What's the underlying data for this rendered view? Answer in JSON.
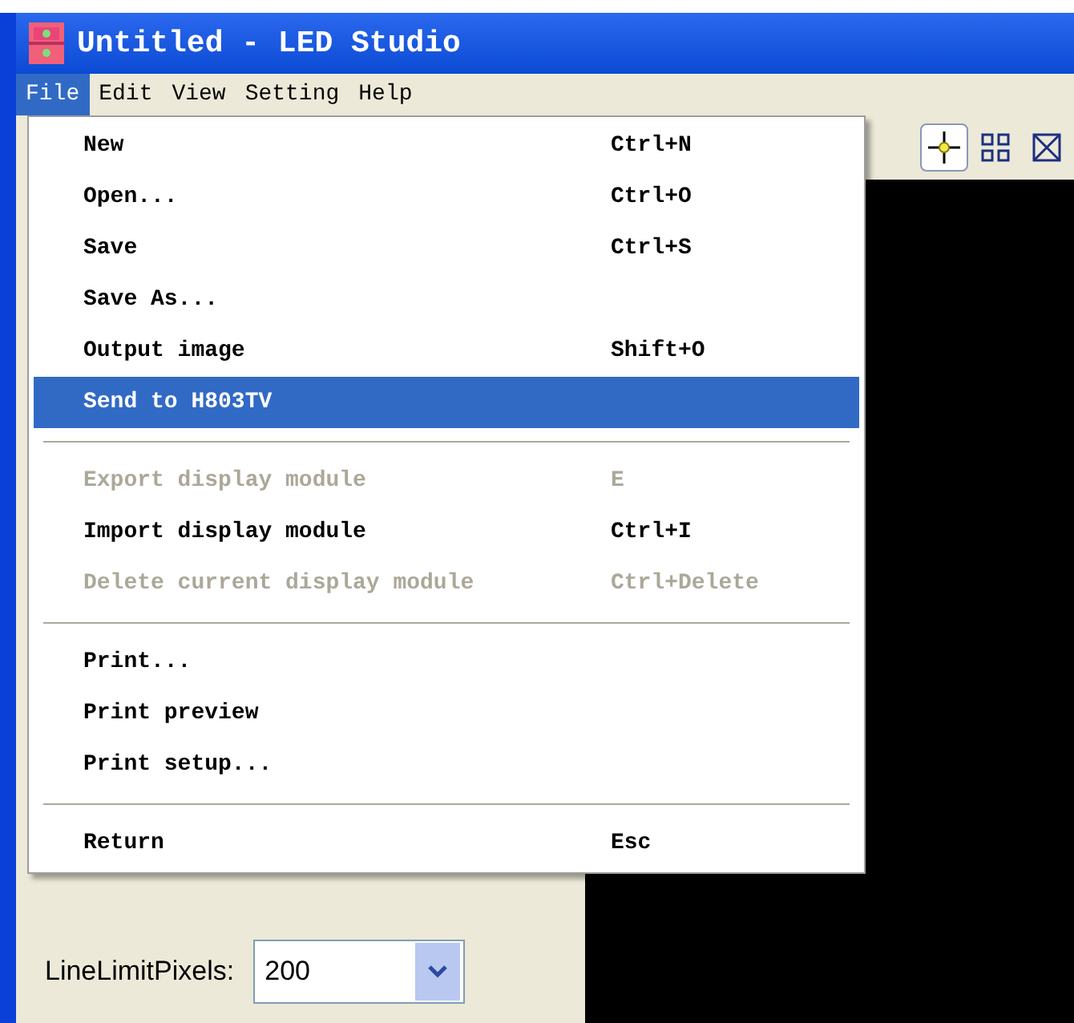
{
  "window": {
    "title": "Untitled - LED Studio"
  },
  "menubar": [
    {
      "label": "File",
      "selected": true
    },
    {
      "label": "Edit",
      "selected": false
    },
    {
      "label": "View",
      "selected": false
    },
    {
      "label": "Setting",
      "selected": false
    },
    {
      "label": "Help",
      "selected": false
    }
  ],
  "file_menu": [
    {
      "kind": "item",
      "label": "New",
      "shortcut": "Ctrl+N",
      "disabled": false,
      "selected": false
    },
    {
      "kind": "item",
      "label": "Open...",
      "shortcut": "Ctrl+O",
      "disabled": false,
      "selected": false
    },
    {
      "kind": "item",
      "label": "Save",
      "shortcut": "Ctrl+S",
      "disabled": false,
      "selected": false
    },
    {
      "kind": "item",
      "label": "Save As...",
      "disabled": false,
      "selected": false
    },
    {
      "kind": "item",
      "label": "Output image",
      "shortcut": "Shift+O",
      "disabled": false,
      "selected": false
    },
    {
      "kind": "item",
      "label": "Send to H803TV",
      "disabled": false,
      "selected": true
    },
    {
      "kind": "separator"
    },
    {
      "kind": "item",
      "label": "Export display module",
      "shortcut": "E",
      "disabled": true,
      "selected": false
    },
    {
      "kind": "item",
      "label": "Import display module",
      "shortcut": "Ctrl+I",
      "disabled": false,
      "selected": false
    },
    {
      "kind": "item",
      "label": "Delete current display module",
      "shortcut": "Ctrl+Delete",
      "disabled": true,
      "selected": false
    },
    {
      "kind": "separator"
    },
    {
      "kind": "item",
      "label": "Print...",
      "disabled": false,
      "selected": false
    },
    {
      "kind": "item",
      "label": "Print preview",
      "disabled": false,
      "selected": false
    },
    {
      "kind": "item",
      "label": "Print setup...",
      "disabled": false,
      "selected": false
    },
    {
      "kind": "separator"
    },
    {
      "kind": "item",
      "label": "Return",
      "shortcut": "Esc",
      "disabled": false,
      "selected": false
    }
  ],
  "toolbar": {
    "tools": [
      {
        "kind": "crosshair",
        "selected": true
      },
      {
        "kind": "grid",
        "selected": false
      },
      {
        "kind": "cross-box",
        "selected": false
      }
    ]
  },
  "line_limit": {
    "label": "LineLimitPixels:",
    "value": "200"
  }
}
